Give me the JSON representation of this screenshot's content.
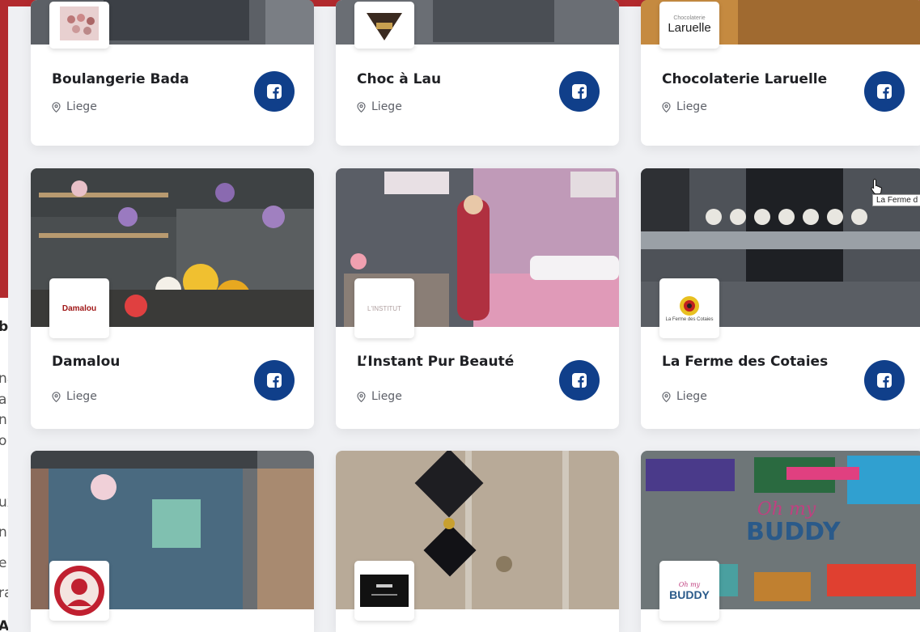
{
  "left_text": {
    "line_bold": "b",
    "lines": [
      "na",
      "ai",
      "n",
      "o",
      "ux",
      "n",
      "e",
      "ra"
    ],
    "bottom_cut": "ABOS"
  },
  "row1": [
    {
      "title": "Boulangerie Bada",
      "location": "Liege"
    },
    {
      "title": "Choc à Lau",
      "location": "Liege"
    },
    {
      "title": "Chocolaterie Laruelle",
      "location": "Liege",
      "logo_text": "Laruelle",
      "logo_top_text": "Chocolaterie"
    }
  ],
  "row2": [
    {
      "title": "Damalou",
      "location": "Liege",
      "logo_text": "Damalou"
    },
    {
      "title": "L’Instant Pur Beauté",
      "location": "Liege",
      "logo_text": "L'INSTITUT"
    },
    {
      "title": "La Ferme des Cotaies",
      "location": "Liege",
      "logo_text": "La Ferme des Cotaies"
    }
  ],
  "row3": [
    {
      "title": "",
      "location": ""
    },
    {
      "title": "",
      "location": ""
    },
    {
      "title": "",
      "location": "",
      "logo_text": "BUDDY",
      "banner_text": "BUDDY",
      "banner_script": "Oh my"
    }
  ],
  "tooltip": "La Ferme d",
  "colors": {
    "facebook_button": "#103f8a",
    "red_block": "#b22a2e"
  }
}
